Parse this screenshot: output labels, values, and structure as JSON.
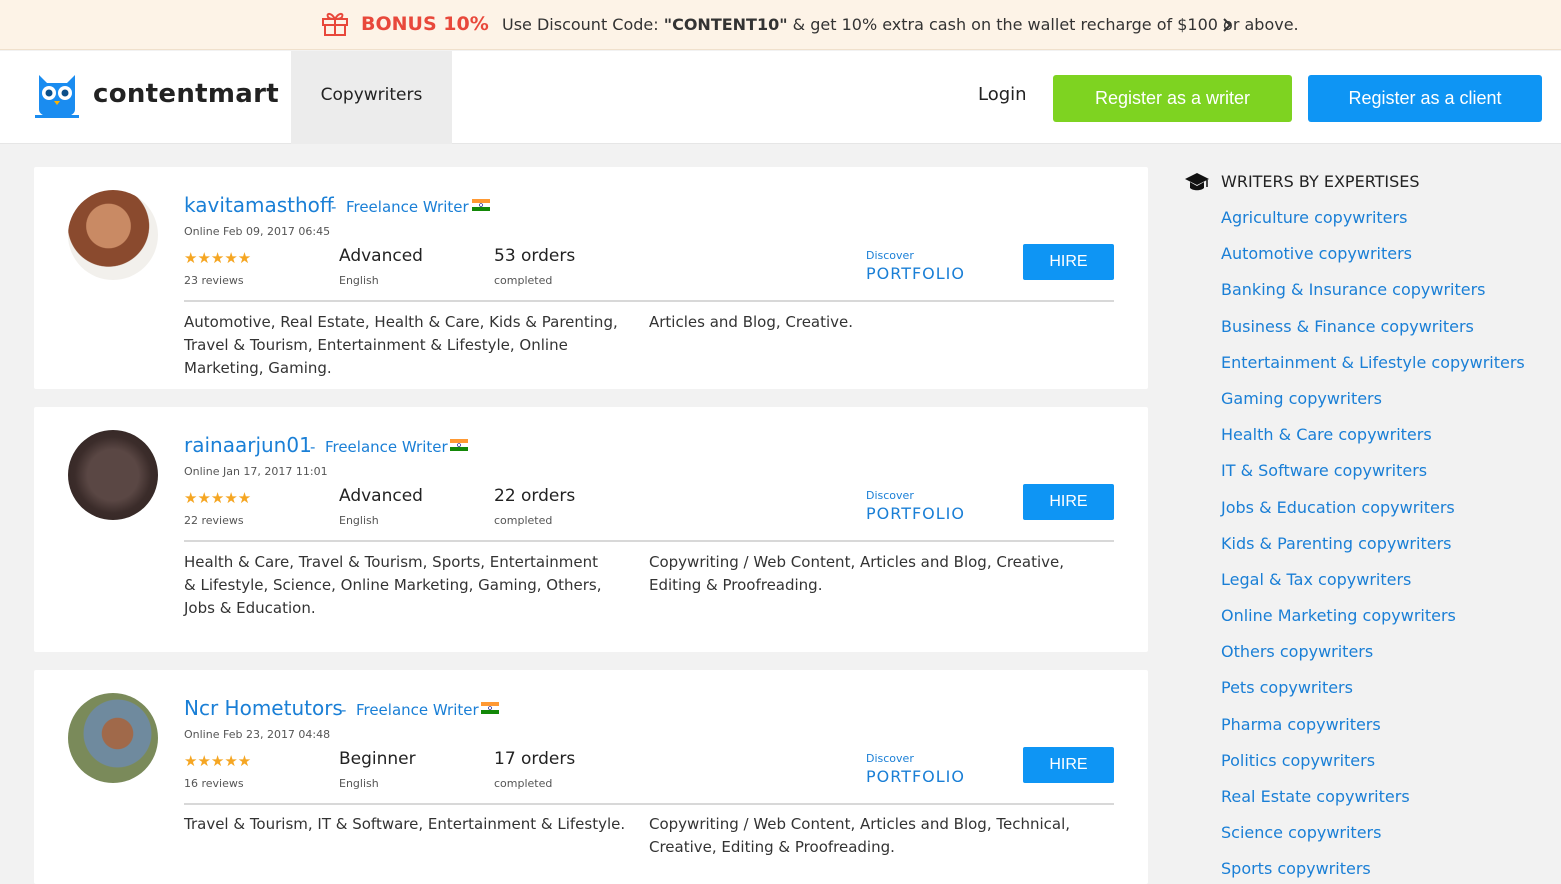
{
  "promo": {
    "bonus": "BONUS 10%",
    "text_before": "Use Discount Code: ",
    "code": "\"CONTENT10\"",
    "text_after": " & get 10% extra cash on the wallet recharge of  $100 or above.",
    "icon": "gift-icon",
    "accent": "#e8483b"
  },
  "header": {
    "logo_text": "contentmart",
    "nav_tab": "Copywriters",
    "login": "Login",
    "register_writer": "Register as a writer",
    "register_client": "Register as a client",
    "writer_color": "#7ed321",
    "client_color": "#0e95f4"
  },
  "writers": [
    {
      "name": "kavitamasthoff",
      "role": "Freelance Writer",
      "online": "Online Feb 09, 2017 06:45",
      "stars": "★★★★★",
      "reviews": "23 reviews",
      "level": "Advanced",
      "language": "English",
      "orders": "53 orders",
      "orders_note": "completed",
      "discover": "Discover",
      "portfolio": "PORTFOLIO",
      "hire": "HIRE",
      "categories": "Automotive, Real Estate, Health & Care, Kids & Parenting, Travel & Tourism, Entertainment & Lifestyle, Online Marketing, Gaming.",
      "skills": "Articles and Blog, Creative."
    },
    {
      "name": "rainaarjun01",
      "role": "Freelance Writer",
      "online": "Online Jan 17, 2017 11:01",
      "stars": "★★★★★",
      "reviews": "22 reviews",
      "level": "Advanced",
      "language": "English",
      "orders": "22 orders",
      "orders_note": "completed",
      "discover": "Discover",
      "portfolio": "PORTFOLIO",
      "hire": "HIRE",
      "categories": "Health & Care, Travel & Tourism, Sports, Entertainment & Lifestyle, Science, Online Marketing, Gaming, Others, Jobs & Education.",
      "skills": "Copywriting / Web Content, Articles and Blog, Creative, Editing & Proofreading."
    },
    {
      "name": "Ncr Hometutors",
      "role": "Freelance Writer",
      "online": "Online Feb 23, 2017 04:48",
      "stars": "★★★★★",
      "reviews": "16 reviews",
      "level": "Beginner",
      "language": "English",
      "orders": "17 orders",
      "orders_note": "completed",
      "discover": "Discover",
      "portfolio": "PORTFOLIO",
      "hire": "HIRE",
      "categories": "Travel & Tourism, IT & Software, Entertainment & Lifestyle.",
      "skills": "Copywriting / Web Content, Articles and Blog, Technical, Creative, Editing & Proofreading."
    }
  ],
  "sidebar": {
    "title": "WRITERS BY EXPERTISES",
    "icon": "graduation-cap-icon",
    "items": [
      "Agriculture copywriters",
      "Automotive copywriters",
      "Banking & Insurance copywriters",
      "Business & Finance copywriters",
      "Entertainment & Lifestyle copywriters",
      "Gaming copywriters",
      "Health & Care copywriters",
      "IT & Software copywriters",
      "Jobs & Education copywriters",
      "Kids & Parenting copywriters",
      "Legal & Tax copywriters",
      "Online Marketing copywriters",
      "Others copywriters",
      "Pets copywriters",
      "Pharma copywriters",
      "Politics copywriters",
      "Real Estate copywriters",
      "Science copywriters",
      "Sports copywriters"
    ]
  }
}
